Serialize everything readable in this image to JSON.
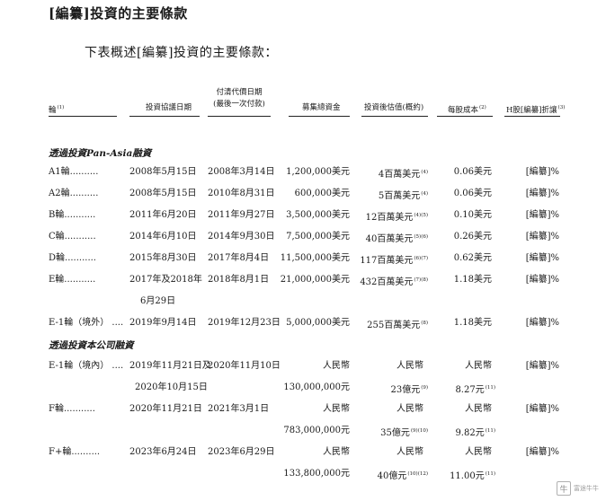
{
  "title": "[編纂]投資的主要條款",
  "intro": "下表概述[編纂]投資的主要條款：",
  "headers": {
    "round": "輪",
    "round_note": "(1)",
    "agreement_date": "投資協議日期",
    "payment_date_1": "付清代價日期",
    "payment_date_2": "(最後一次付款)",
    "total_raised": "募集總資金",
    "valuation": "投資後估值(概約)",
    "cost_per_share": "每股成本",
    "cost_note": "(2)",
    "discount": "H股[編纂]折讓",
    "discount_note": "(3)"
  },
  "groups": {
    "pan_asia": "透過投資Pan-Asia融資",
    "company": "透過投資本公司融資"
  },
  "rows": [
    {
      "round": "A1輪..........",
      "agree": "2008年5月15日",
      "pay": "2008年3月14日",
      "raised": "1,200,000美元",
      "val": "4百萬美元",
      "val_note": "(4)",
      "cost": "0.06美元",
      "cost_note": "",
      "disc": "[編纂]%"
    },
    {
      "round": "A2輪..........",
      "agree": "2008年5月15日",
      "pay": "2010年8月31日",
      "raised": "600,000美元",
      "val": "5百萬美元",
      "val_note": "(4)",
      "cost": "0.06美元",
      "cost_note": "",
      "disc": "[編纂]%"
    },
    {
      "round": "B輪...........",
      "agree": "2011年6月20日",
      "pay": "2011年9月27日",
      "raised": "3,500,000美元",
      "val": "12百萬美元",
      "val_note": "(4)(5)",
      "cost": "0.10美元",
      "cost_note": "",
      "disc": "[編纂]%"
    },
    {
      "round": "C輪...........",
      "agree": "2014年6月10日",
      "pay": "2014年9月30日",
      "raised": "7,500,000美元",
      "val": "40百萬美元",
      "val_note": "(5)(6)",
      "cost": "0.26美元",
      "cost_note": "",
      "disc": "[編纂]%"
    },
    {
      "round": "D輪...........",
      "agree": "2015年8月30日",
      "pay": "2017年8月4日",
      "raised": "11,500,000美元",
      "val": "117百萬美元",
      "val_note": "(6)(7)",
      "cost": "0.62美元",
      "cost_note": "",
      "disc": "[編纂]%"
    },
    {
      "round": "E輪...........",
      "agree": "2017年及2018年",
      "agree2": "6月29日",
      "pay": "2018年8月1日",
      "raised": "21,000,000美元",
      "val": "432百萬美元",
      "val_note": "(7)(8)",
      "cost": "1.18美元",
      "cost_note": "",
      "disc": "[編纂]%"
    },
    {
      "round": "E-1輪（境外） ....",
      "agree": "2019年9月14日",
      "pay": "2019年12月23日",
      "raised": "5,000,000美元",
      "val": "255百萬美元",
      "val_note": "(8)",
      "cost": "1.18美元",
      "cost_note": "",
      "disc": "[編纂]%"
    },
    {
      "round": "E-1輪（境內） ....",
      "agree": "2019年11月21日及",
      "agree2": "2020年10月15日",
      "pay": "2020年11月10日",
      "raised_cur": "人民幣",
      "raised": "130,000,000元",
      "val_cur": "人民幣",
      "val": "23億元",
      "val_note": "(9)",
      "cost_cur": "人民幣",
      "cost": "8.27元",
      "cost_note": "(11)",
      "disc": "[編纂]%"
    },
    {
      "round": "F輪...........",
      "agree": "2020年11月21日",
      "pay": "2021年3月1日",
      "raised_cur": "人民幣",
      "raised": "783,000,000元",
      "val_cur": "人民幣",
      "val": "35億元",
      "val_note": "(9)(10)",
      "cost_cur": "人民幣",
      "cost": "9.82元",
      "cost_note": "(11)",
      "disc": "[編纂]%"
    },
    {
      "round": "F+輪..........",
      "agree": "2023年6月24日",
      "pay": "2023年6月29日",
      "raised_cur": "人民幣",
      "raised": "133,800,000元",
      "val_cur": "人民幣",
      "val": "40億元",
      "val_note": "(10)(12)",
      "cost_cur": "人民幣",
      "cost": "11.00元",
      "cost_note": "(11)",
      "disc": "[編纂]%"
    }
  ],
  "watermark": "富途牛牛"
}
